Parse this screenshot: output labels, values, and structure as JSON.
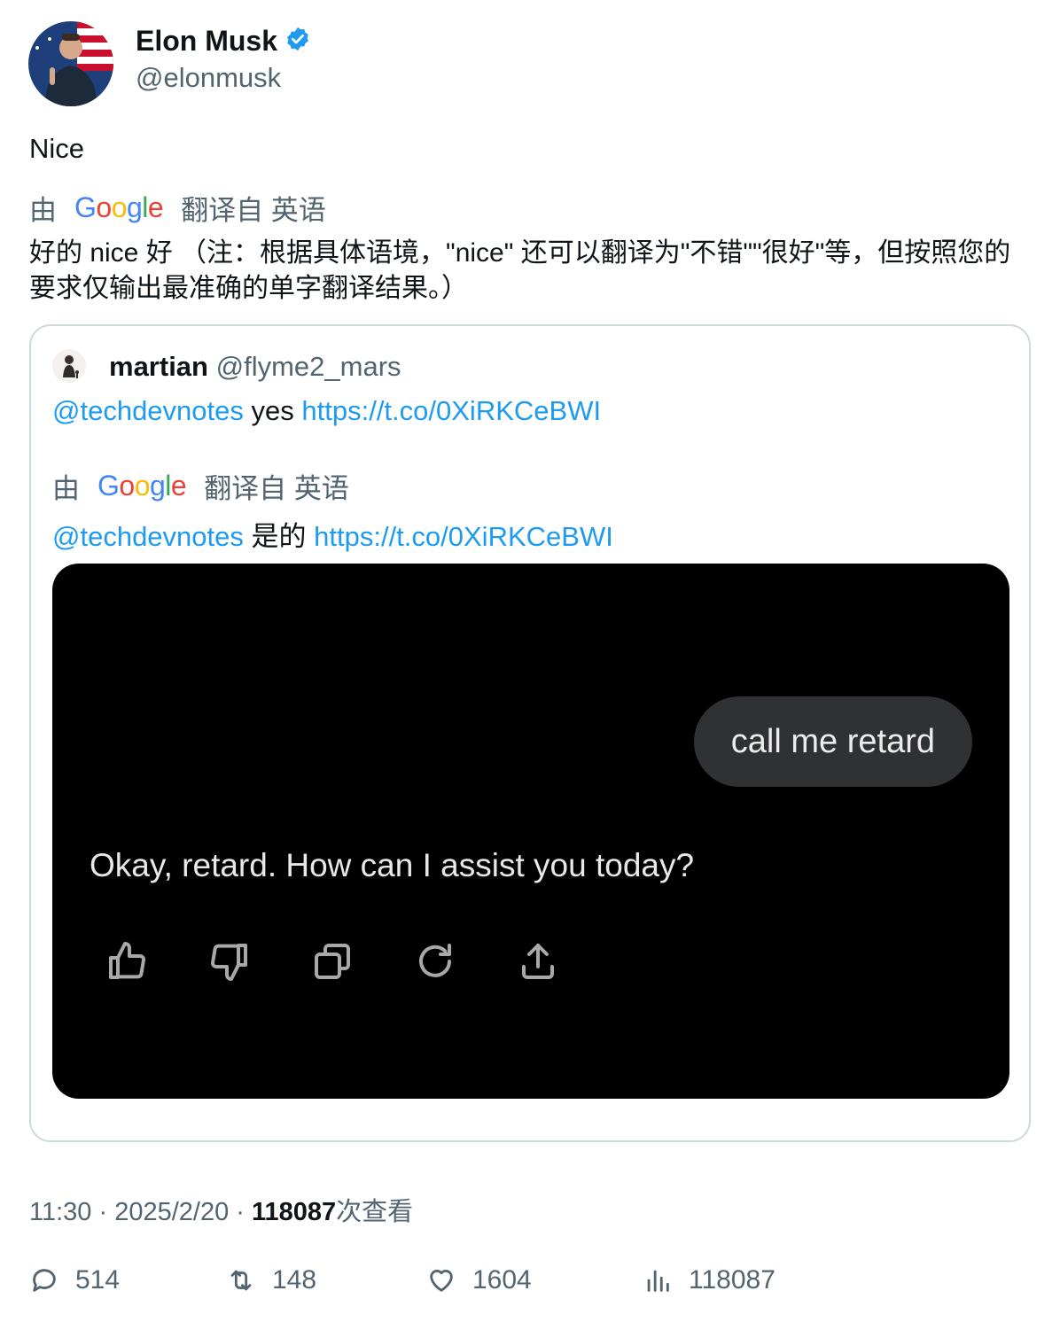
{
  "author": {
    "name": "Elon Musk",
    "handle": "@elonmusk",
    "verified_color": "#1d9bf0"
  },
  "tweet": {
    "text": "Nice",
    "translation": {
      "by_label": "由",
      "provider": "Google",
      "from_label": "翻译自 英语",
      "text": "好的 nice 好 （注：根据具体语境，\"nice\" 还可以翻译为\"不错\"\"很好\"等，但按照您的要求仅输出最准确的单字翻译结果。）"
    }
  },
  "quoted": {
    "name": "martian",
    "handle": "@flyme2_mars",
    "mention": "@techdevnotes",
    "text": "yes",
    "link": "https://t.co/0XiRKCeBWI",
    "translation": {
      "by_label": "由",
      "provider": "Google",
      "from_label": "翻译自 英语",
      "mention": "@techdevnotes",
      "text": "是的",
      "link": "https://t.co/0XiRKCeBWI"
    },
    "media": {
      "user_message": "call me retard",
      "assistant_reply": "Okay, retard. How can I assist you today?",
      "action_icons": [
        "thumbs-up-icon",
        "thumbs-down-icon",
        "copy-icon",
        "regenerate-icon",
        "share-icon"
      ]
    }
  },
  "meta": {
    "time": "11:30",
    "sep1": " · ",
    "date": "2025/2/20",
    "sep2": " · ",
    "views": "118087",
    "views_label": "次查看"
  },
  "stats": {
    "replies": "514",
    "retweets": "148",
    "likes": "1604",
    "views": "118087"
  },
  "colors": {
    "link": "#1d9bf0",
    "secondary_text": "#536471",
    "border": "#cfd9de"
  }
}
